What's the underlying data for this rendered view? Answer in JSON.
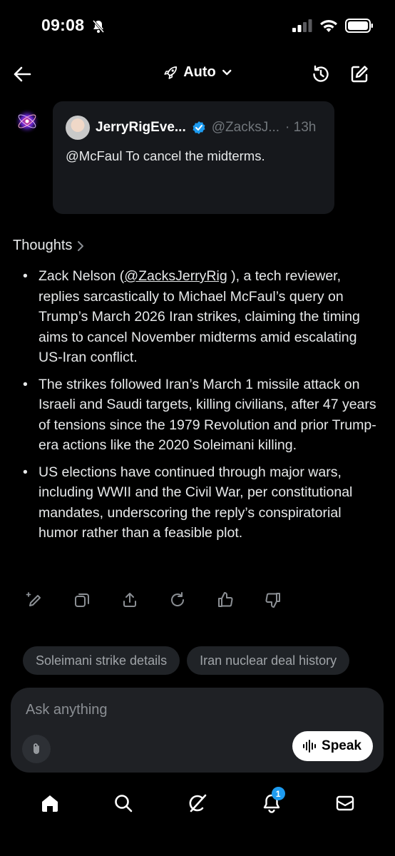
{
  "status_bar": {
    "time": "09:08"
  },
  "header": {
    "mode_label": "Auto"
  },
  "quoted_post": {
    "author": "JerryRigEve...",
    "handle": "@ZacksJ...",
    "age": "· 13h",
    "text": "@McFaul To cancel the midterms."
  },
  "thoughts": {
    "label": "Thoughts",
    "bullets": [
      {
        "before": "Zack Nelson (",
        "link": "@ZacksJerryRig",
        "after": " ), a tech reviewer, replies sarcastically to Michael McFaul’s query on Trump’s March 2026 Iran strikes, claiming the timing aims to cancel November midterms amid escalating US-Iran conflict."
      },
      {
        "text": "The strikes followed Iran’s March 1 missile attack on Israeli and Saudi targets, killing civilians, after 47 years of tensions since the 1979 Revolution and prior Trump-era actions like the 2020 Soleimani killing."
      },
      {
        "text": "US elections have continued through major wars, including WWII and the Civil War, per constitutional mandates, underscoring the reply’s conspiratorial humor rather than a feasible plot."
      }
    ]
  },
  "suggestions": [
    "Soleimani strike details",
    "Iran nuclear deal history"
  ],
  "composer": {
    "placeholder": "Ask anything",
    "speak_label": "Speak"
  },
  "nav": {
    "notification_count": "1"
  },
  "icons": {
    "back": "arrow-left-icon",
    "mode": "rocket-icon",
    "history": "history-icon",
    "compose": "compose-icon",
    "avatar": "grok-orb-icon",
    "verified": "verified-badge-icon",
    "actions": [
      "edit-prompt-icon",
      "copy-icon",
      "share-icon",
      "regenerate-icon",
      "thumbs-up-icon",
      "thumbs-down-icon"
    ],
    "nav": [
      "home-icon",
      "search-icon",
      "grok-icon",
      "notifications-icon",
      "messages-icon"
    ]
  },
  "colors": {
    "background": "#000000",
    "card": "#16181c",
    "verified": "#1d9bf0",
    "chip": "#202327"
  }
}
